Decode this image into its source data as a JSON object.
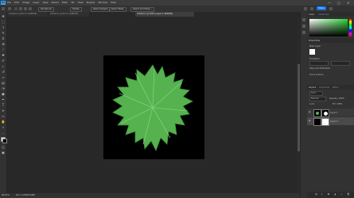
{
  "app": {
    "logo": "Ps"
  },
  "menu": [
    "File",
    "Edit",
    "Image",
    "Layer",
    "Type",
    "Select",
    "Filter",
    "3D",
    "View",
    "Plugins",
    "Window",
    "Help"
  ],
  "window_controls": {
    "minimize": "—",
    "maximize": "▢",
    "close": "✕"
  },
  "options_bar": {
    "select_subject": "Select Subject",
    "select_mask": "Select and Mask...",
    "field1": "Sample All",
    "btn1": "Delete",
    "btn2": "Select Mask"
  },
  "share_label": "Share",
  "tabs": [
    {
      "label": "Untitled-1 @ 66.7% (RGB/8#)",
      "active": false
    },
    {
      "label": "Untitled-2 @ 66.7% (RGB/8#)",
      "active": false
    },
    {
      "label": "Untitled-1 @ 100% (Layer 0, RGB/8#)",
      "active": true
    }
  ],
  "status": {
    "zoom": "66.67%",
    "doc": "Doc: 2.25M/3.00M"
  },
  "color_panel": {
    "title": "Color",
    "tab2": "Swatches"
  },
  "properties_panel": {
    "title": "Properties",
    "section": "Pixel Layer",
    "transform": "Transform",
    "align": "Align and Distribute",
    "quick": "Quick Actions"
  },
  "layers_panel": {
    "tabs": [
      "Layers",
      "Channels",
      "Paths"
    ],
    "kind": "Kind",
    "blend": "Normal",
    "opacity": "Opacity: 100%",
    "lock": "Lock:",
    "fill": "Fill: 100%",
    "layers": [
      {
        "name": "Layer 1",
        "visible": true
      },
      {
        "name": "Layer 0",
        "visible": true
      }
    ]
  },
  "colors": {
    "accent": "#1473e6",
    "leaf": "#55b24f",
    "leaf_dark": "#3f8f3a"
  }
}
